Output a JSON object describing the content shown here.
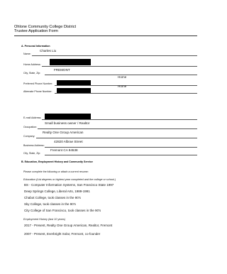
{
  "header": {
    "line1": "Ohlone Community College District",
    "line2": "Trustee Application Form"
  },
  "section_a": {
    "heading": "A.    Personal Information",
    "name_label": "Name:",
    "name_value": "Charles Liu",
    "home_address_label": "Home Address:",
    "city_state_zip_label": "City, State, Zip:",
    "city_state_zip_value": "FREMONT",
    "preferred_phone_label": "Preferred Phone Number:",
    "preferred_phone_type": "Home",
    "alternate_phone_label": "Alternate Phone Number:",
    "alternate_phone_type": "Home",
    "email_label": "E-mail Address:",
    "occupation_label": "Occupation:",
    "occupation_value": "Small business owner / Realtor",
    "company_label": "Company:",
    "company_value": "Realty One Group American",
    "business_address_label": "Business Address:",
    "business_address_value": "42820 Albrae Street",
    "business_city_label": "City, State, Zip:",
    "business_city_value": "Fremont CA 94538"
  },
  "section_b": {
    "heading": "B.    Education, Employment History and Community Service",
    "instruction": "Please complete the following or attach a current resume:",
    "education_label": "Education (List degrees or highest year completed and the college or school.)",
    "education": [
      "BS - Computer Information Systems, San Francisco State 1997",
      "Deep Springs College, Liberal Arts, 1989-1991",
      "Chabot College, took classes in the 90's",
      "Sky College, took classes in the 90's",
      "City College of San Francisco, took classes in the 90's"
    ],
    "employment_label": "Employment History (last 10 years)",
    "employment": [
      "2017 - Present, Realty One Group American, Realtor, Fremont",
      "2007 - Present, Everbright Solar, Fremont, co-founder"
    ]
  }
}
